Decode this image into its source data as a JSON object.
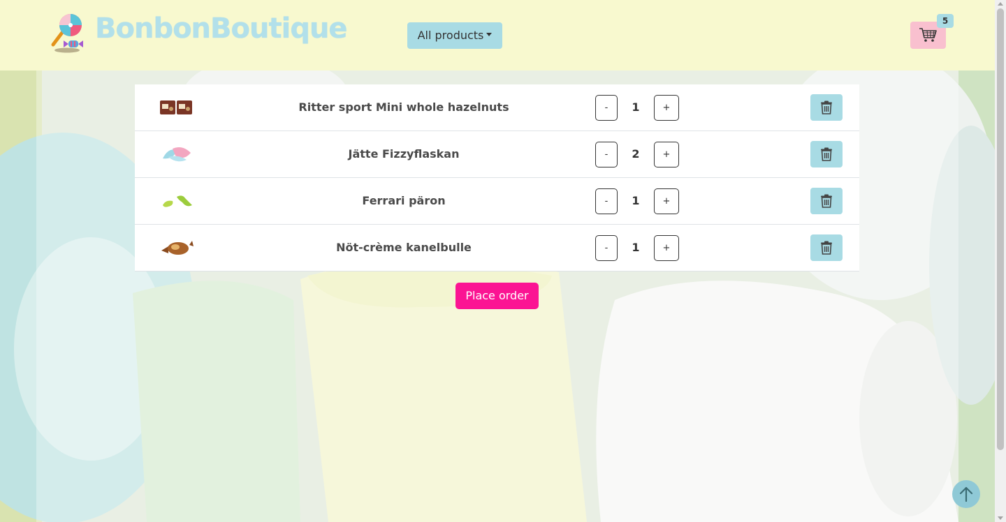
{
  "header": {
    "brand": "BonbonBoutique",
    "nav_dropdown_label": "All products",
    "cart_count": "5"
  },
  "cart": {
    "items": [
      {
        "name": "Ritter sport Mini whole hazelnuts",
        "quantity": "1",
        "minus_label": "-",
        "plus_label": "+"
      },
      {
        "name": "Jätte Fizzyflaskan",
        "quantity": "2",
        "minus_label": "-",
        "plus_label": "+"
      },
      {
        "name": "Ferrari päron",
        "quantity": "1",
        "minus_label": "-",
        "plus_label": "+"
      },
      {
        "name": "Nöt-crème kanelbulle",
        "quantity": "1",
        "minus_label": "-",
        "plus_label": "+"
      }
    ],
    "place_order_label": "Place order"
  },
  "icons": {
    "logo": "lollipop-candy-icon",
    "cart": "shopping-cart-icon",
    "delete": "trash-icon",
    "scroll_top": "arrow-up-icon"
  },
  "colors": {
    "header_bg": "#f8f9cf",
    "brand": "#b2e0ea",
    "accent_blue": "#a8dbe4",
    "cart_pink": "#f9c0cf",
    "order_button": "#fb1493"
  }
}
